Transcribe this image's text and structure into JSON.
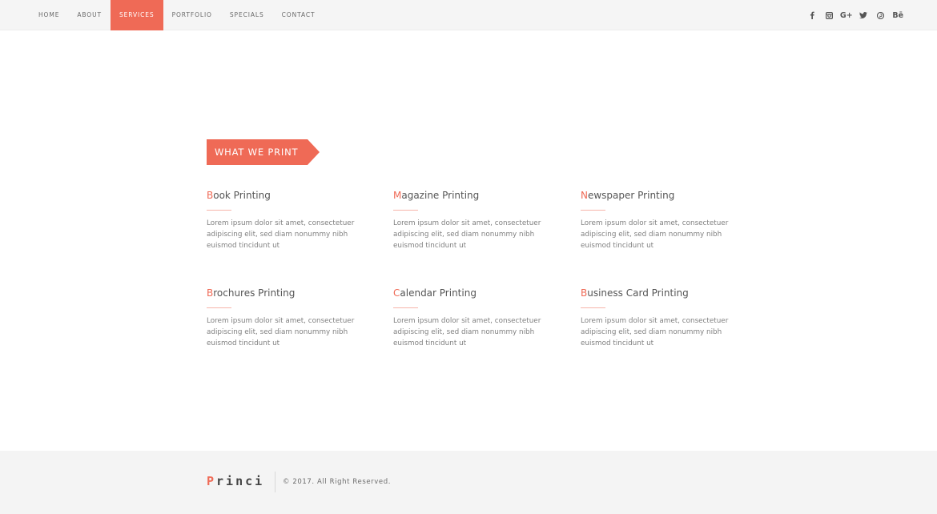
{
  "nav": {
    "items": [
      {
        "label": "HOME"
      },
      {
        "label": "ABOUT"
      },
      {
        "label": "SERVICES",
        "active": true
      },
      {
        "label": "PORTFOLIO"
      },
      {
        "label": "SPECIALS"
      },
      {
        "label": "CONTACT"
      }
    ]
  },
  "social": {
    "icons": [
      "facebook-icon",
      "instagram-icon",
      "google-plus-icon",
      "twitter-icon",
      "pinterest-icon",
      "behance-icon"
    ],
    "google_plus_text": "G+",
    "behance_text": "Bē"
  },
  "section": {
    "badge_label": "WHAT WE PRINT"
  },
  "services": [
    {
      "first": "B",
      "rest": "ook Printing",
      "desc": "Lorem ipsum dolor sit amet, consectetuer adipiscing elit, sed diam nonummy nibh euismod tincidunt ut"
    },
    {
      "first": "M",
      "rest": "agazine Printing",
      "desc": "Lorem ipsum dolor sit amet, consectetuer adipiscing elit, sed diam nonummy nibh euismod tincidunt ut"
    },
    {
      "first": "N",
      "rest": "ewspaper Printing",
      "desc": "Lorem ipsum dolor sit amet, consectetuer adipiscing elit, sed diam nonummy nibh euismod tincidunt ut"
    },
    {
      "first": "B",
      "rest": "rochures Printing",
      "desc": "Lorem ipsum dolor sit amet, consectetuer adipiscing elit, sed diam nonummy nibh euismod tincidunt ut"
    },
    {
      "first": "C",
      "rest": "alendar Printing",
      "desc": "Lorem ipsum dolor sit amet, consectetuer adipiscing elit, sed diam nonummy nibh euismod tincidunt ut"
    },
    {
      "first": "B",
      "rest": "usiness Card Printing",
      "desc": "Lorem ipsum dolor sit amet, consectetuer adipiscing elit, sed diam nonummy nibh euismod tincidunt ut"
    }
  ],
  "footer": {
    "logo_first": "P",
    "logo_rest": "rinci",
    "copyright": "© 2017. All Right Reserved."
  },
  "colors": {
    "accent": "#ef6a56",
    "nav_bg": "#f5f5f5",
    "footer_bg": "#f4f4f4"
  }
}
